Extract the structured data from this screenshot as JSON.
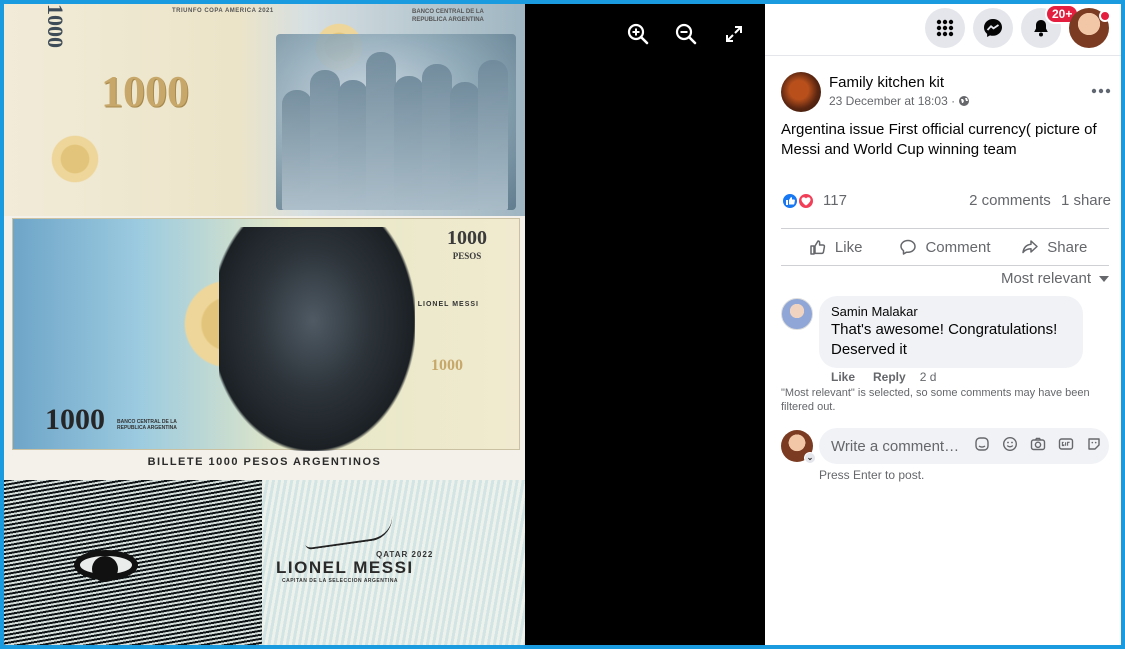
{
  "photo": {
    "note_top": {
      "denomination": "1000",
      "vertical_denomination": "1000",
      "title_line": "TRIUNFO COPA AMERICA 2021",
      "bank_line_1": "BANCO CENTRAL DE LA",
      "bank_line_2": "REPUBLICA ARGENTINA"
    },
    "note_mid": {
      "denomination_top": "1000",
      "currency_top": "PESOS",
      "signature_name": "LIONEL MESSI",
      "denomination_mid": "1000",
      "denomination_bottom": "1000",
      "bank_line": "BANCO CENTRAL DE LA REPUBLICA ARGENTINA"
    },
    "caption": "BILLETE 1000 PESOS ARGENTINOS",
    "note_bottom": {
      "event": "QATAR 2022",
      "name": "LIONEL MESSI",
      "subtitle": "CAPITAN DE LA SELECCION ARGENTINA"
    }
  },
  "viewer": {
    "zoom_in": "zoom-in",
    "zoom_out": "zoom-out",
    "fullscreen": "fullscreen"
  },
  "topbar": {
    "notifications_badge": "20+"
  },
  "post": {
    "author": "Family kitchen kit",
    "timestamp": "23 December at 18:03 ·",
    "text": "Argentina issue First official currency( picture of Messi and World Cup winning team",
    "reaction_count": "117",
    "comments_count": "2 comments",
    "shares_count": "1 share",
    "actions": {
      "like": "Like",
      "comment": "Comment",
      "share": "Share"
    },
    "sort_label": "Most relevant"
  },
  "comment": {
    "author": "Samin Malakar",
    "text": "That's awesome! Congratulations! Deserved it",
    "like": "Like",
    "reply": "Reply",
    "time": "2 d"
  },
  "notice": "\"Most relevant\" is selected, so some comments may have been filtered out.",
  "composer": {
    "placeholder": "Write a comment…",
    "hint": "Press Enter to post."
  },
  "colors": {
    "facebook_blue": "#1877f2",
    "love_red": "#f33e58",
    "badge_red": "#e41e3f",
    "frame_blue": "#1a9be0"
  }
}
